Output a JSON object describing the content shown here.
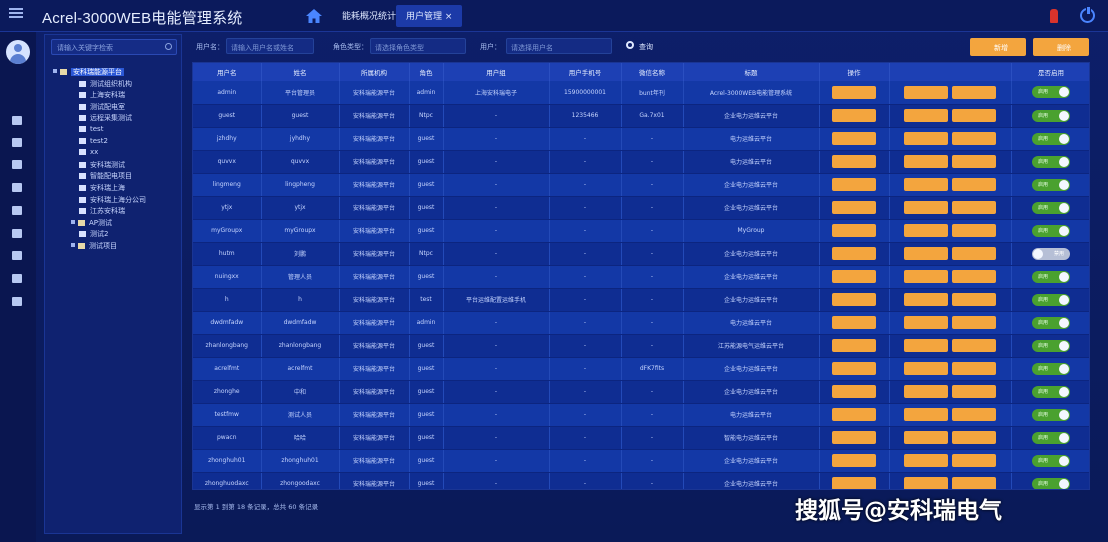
{
  "app": {
    "title": "Acrel-3000WEB电能管理系统"
  },
  "tabs": [
    {
      "label": "能耗概况统计"
    },
    {
      "label": "用户管理 ×"
    }
  ],
  "tree": {
    "search_placeholder": "请输入关键字检索",
    "items": [
      {
        "label": "安科瑞能源平台",
        "level": 0,
        "type": "folder",
        "selected": true
      },
      {
        "label": "测试组织机构",
        "level": 1,
        "type": "file"
      },
      {
        "label": "上海安科瑞",
        "level": 1,
        "type": "file"
      },
      {
        "label": "测试配电室",
        "level": 1,
        "type": "file"
      },
      {
        "label": "远程采集测试",
        "level": 1,
        "type": "file"
      },
      {
        "label": "test",
        "level": 1,
        "type": "file"
      },
      {
        "label": "test2",
        "level": 1,
        "type": "file"
      },
      {
        "label": "xx",
        "level": 1,
        "type": "file"
      },
      {
        "label": "安科瑞测试",
        "level": 1,
        "type": "file"
      },
      {
        "label": "智能配电项目",
        "level": 1,
        "type": "file"
      },
      {
        "label": "安科瑞上海",
        "level": 1,
        "type": "file"
      },
      {
        "label": "安科瑞上海分公司",
        "level": 1,
        "type": "file"
      },
      {
        "label": "江苏安科瑞",
        "level": 1,
        "type": "file"
      },
      {
        "label": "AP测试",
        "level": 1,
        "type": "folder"
      },
      {
        "label": "测试2",
        "level": 1,
        "type": "file"
      },
      {
        "label": "测试项目",
        "level": 1,
        "type": "folder"
      }
    ]
  },
  "filters": {
    "username_label": "用户名：",
    "username_placeholder": "请输入用户名或姓名",
    "role_label": "角色类型：",
    "role_placeholder": "请选择角色类型",
    "user_label": "用户：",
    "user_placeholder": "请选择用户名",
    "query_label": "查询",
    "add_label": "新增",
    "delete_label": "删除"
  },
  "table": {
    "headers": [
      "用户名",
      "姓名",
      "所属机构",
      "角色",
      "用户组",
      "用户手机号",
      "微信名称",
      "标题",
      "操作",
      "",
      "是否启用"
    ],
    "rows": [
      {
        "cells": [
          "admin",
          "平台管理员",
          "安科瑞能源平台",
          "admin",
          "上海安科瑞电子",
          "15900000001",
          "bunt年刊",
          "Acrel-3000WEB电能管理系统"
        ],
        "enabled": true
      },
      {
        "cells": [
          "guest",
          "guest",
          "安科瑞能源平台",
          "Ntpc",
          "-",
          "1235466",
          "Ga.7x01",
          "企业电力运维云平台"
        ],
        "enabled": true
      },
      {
        "cells": [
          "jzhdhy",
          "jyhdhy",
          "安科瑞能源平台",
          "guest",
          "-",
          "-",
          "-",
          "电力运维云平台"
        ],
        "enabled": true
      },
      {
        "cells": [
          "quvvx",
          "quvvx",
          "安科瑞能源平台",
          "guest",
          "-",
          "-",
          "-",
          "电力运维云平台"
        ],
        "enabled": true
      },
      {
        "cells": [
          "lingmeng",
          "lingpheng",
          "安科瑞能源平台",
          "guest",
          "-",
          "-",
          "-",
          "企业电力运维云平台"
        ],
        "enabled": true
      },
      {
        "cells": [
          "ytjx",
          "ytjx",
          "安科瑞能源平台",
          "guest",
          "-",
          "-",
          "-",
          "企业电力运维云平台"
        ],
        "enabled": true
      },
      {
        "cells": [
          "myGroupx",
          "myGroupx",
          "安科瑞能源平台",
          "guest",
          "-",
          "-",
          "-",
          "MyGroup"
        ],
        "enabled": true
      },
      {
        "cells": [
          "hutm",
          "刘鹏",
          "安科瑞能源平台",
          "Ntpc",
          "-",
          "-",
          "-",
          "企业电力运维云平台"
        ],
        "enabled": false
      },
      {
        "cells": [
          "nuingxx",
          "管理人员",
          "安科瑞能源平台",
          "guest",
          "-",
          "-",
          "-",
          "企业电力运维云平台"
        ],
        "enabled": true
      },
      {
        "cells": [
          "h",
          "h",
          "安科瑞能源平台",
          "test",
          "平台运维配置运维手机",
          "-",
          "-",
          "企业电力运维云平台"
        ],
        "enabled": true
      },
      {
        "cells": [
          "dwdmfadw",
          "dwdmfadw",
          "安科瑞能源平台",
          "admin",
          "-",
          "-",
          "-",
          "电力运维云平台"
        ],
        "enabled": true
      },
      {
        "cells": [
          "zhanlongbang",
          "zhanlongbang",
          "安科瑞能源平台",
          "guest",
          "-",
          "-",
          "-",
          "江苏能源电气运维云平台"
        ],
        "enabled": true
      },
      {
        "cells": [
          "acrelfmt",
          "acrelfmt",
          "安科瑞能源平台",
          "guest",
          "-",
          "-",
          "dFK7fits",
          "企业电力运维云平台"
        ],
        "enabled": true
      },
      {
        "cells": [
          "zhonghe",
          "中和",
          "安科瑞能源平台",
          "guest",
          "-",
          "-",
          "-",
          "企业电力运维云平台"
        ],
        "enabled": true
      },
      {
        "cells": [
          "testfmw",
          "测试人员",
          "安科瑞能源平台",
          "guest",
          "-",
          "-",
          "-",
          "电力运维云平台"
        ],
        "enabled": true
      },
      {
        "cells": [
          "pwacn",
          "哈哈",
          "安科瑞能源平台",
          "guest",
          "-",
          "-",
          "-",
          "智能电力运维云平台"
        ],
        "enabled": true
      },
      {
        "cells": [
          "zhonghuh01",
          "zhonghuh01",
          "安科瑞能源平台",
          "guest",
          "-",
          "-",
          "-",
          "企业电力运维云平台"
        ],
        "enabled": true
      },
      {
        "cells": [
          "zhonghuodaxc",
          "zhongoodaxc",
          "安科瑞能源平台",
          "guest",
          "-",
          "-",
          "-",
          "企业电力运维云平台"
        ],
        "enabled": true
      }
    ],
    "toggle_on_label": "启用",
    "toggle_off_label": "禁用"
  },
  "pager": {
    "text": "显示第 1 到第 18 条记录，总共 60 条记录"
  },
  "watermark": {
    "text": "搜狐号@安科瑞电气"
  },
  "colors": {
    "accent": "#f3a53e",
    "toggle_on": "#4aa12f",
    "background": "#0d1f6a"
  }
}
